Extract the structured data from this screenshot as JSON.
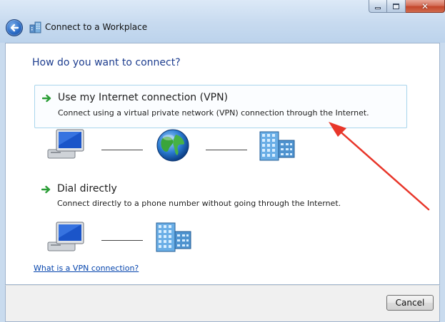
{
  "window": {
    "title": "Connect to a Workplace",
    "caption_buttons": {
      "minimize_icon": "minimize-icon",
      "maximize_icon": "maximize-icon",
      "close_glyph": "✕"
    }
  },
  "main": {
    "heading": "How do you want to connect?",
    "options": [
      {
        "title": "Use my Internet connection (VPN)",
        "description": "Connect using a virtual private network (VPN) connection through the Internet.",
        "icon": "green-arrow-icon",
        "diagram": [
          "computer-icon",
          "globe-icon",
          "office-building-icon"
        ]
      },
      {
        "title": "Dial directly",
        "description": "Connect directly to a phone number without going through the Internet.",
        "icon": "green-arrow-icon",
        "diagram": [
          "computer-icon",
          "office-building-icon"
        ]
      }
    ],
    "help_link": "What is a VPN connection?"
  },
  "footer": {
    "cancel_label": "Cancel"
  },
  "colors": {
    "heading": "#1e3e8f",
    "link": "#0645ad",
    "annotation_arrow": "#e8362a",
    "option_highlight_border": "#a9d5ec"
  }
}
